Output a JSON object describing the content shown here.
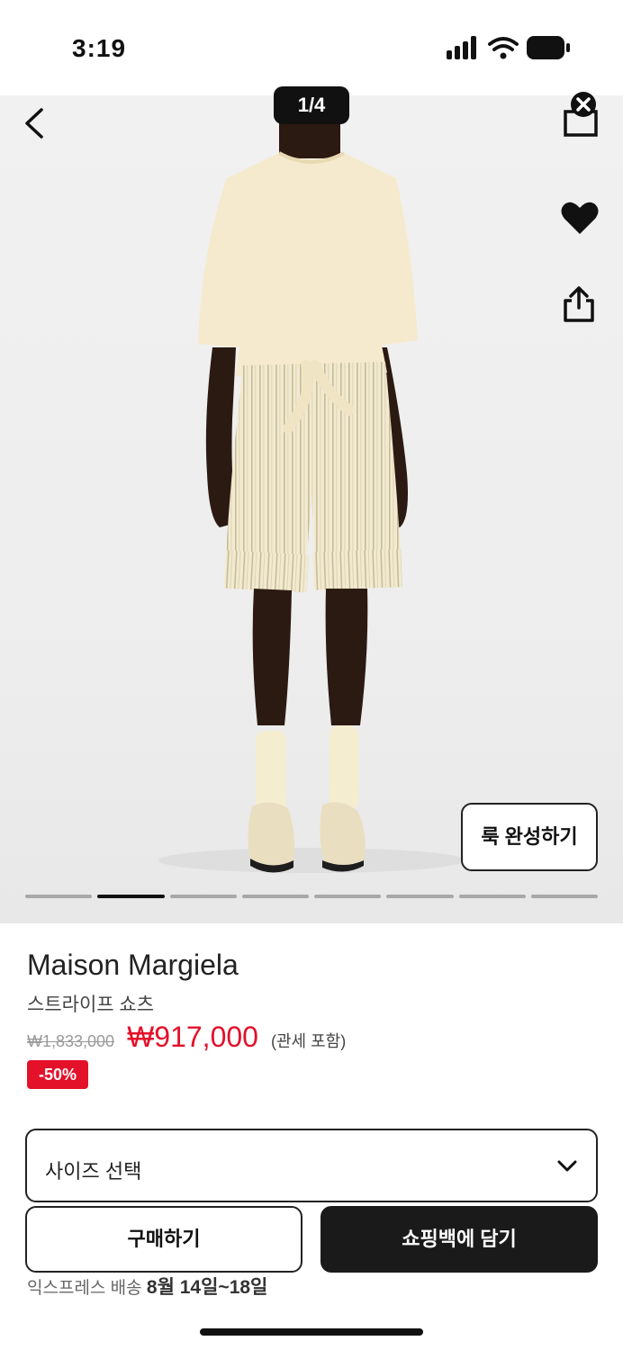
{
  "status_bar": {
    "time": "3:19",
    "battery_level": 0.9
  },
  "gallery": {
    "counter": "1/4",
    "total_slides": 8,
    "active_slide": 2,
    "look_button_label": "룩 완성하기"
  },
  "product": {
    "brand": "Maison Margiela",
    "name": "스트라이프 쇼츠",
    "original_price": "₩1,833,000",
    "sale_price": "₩917,000",
    "price_note": "(관세 포함)",
    "discount": "-50%"
  },
  "purchase": {
    "size_placeholder": "사이즈 선택",
    "buy_label": "구매하기",
    "add_to_bag_label": "쇼핑백에 담기"
  },
  "delivery": {
    "label": "익스프레스 배송",
    "date": "8월 14일~18일"
  },
  "colors": {
    "accent_red": "#e4112a",
    "dark_button": "#1a1a1a"
  },
  "icons": {
    "back": "chevron-left-icon",
    "bag": "shopping-bag-icon",
    "close": "close-icon",
    "wishlist": "heart-icon",
    "share": "share-icon",
    "dropdown": "chevron-down-icon"
  }
}
